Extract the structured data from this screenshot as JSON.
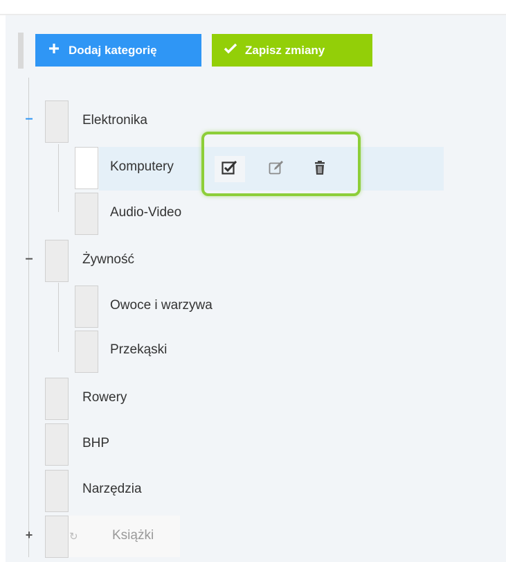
{
  "toolbar": {
    "add_label": "Dodaj kategorię",
    "save_label": "Zapisz zmiany",
    "add_color": "#2f96f5",
    "save_color": "#93cf08"
  },
  "tree": [
    {
      "label": "Elektronika",
      "toggle": "–",
      "expanded": true,
      "children": [
        {
          "label": "Komputery",
          "selected": true
        },
        {
          "label": "Audio-Video"
        }
      ]
    },
    {
      "label": "Żywność",
      "toggle": "–",
      "expanded": true,
      "children": [
        {
          "label": "Owoce i warzywa"
        },
        {
          "label": "Przekąski"
        }
      ]
    },
    {
      "label": "Rowery"
    },
    {
      "label": "BHP"
    },
    {
      "label": "Narzędzia"
    },
    {
      "label": "Książki",
      "toggle": "+",
      "expanded": false,
      "dragging": true
    }
  ],
  "row_actions": {
    "icons": [
      "check-square-icon",
      "edit-icon",
      "trash-icon"
    ],
    "highlight_color": "#8dce39"
  }
}
